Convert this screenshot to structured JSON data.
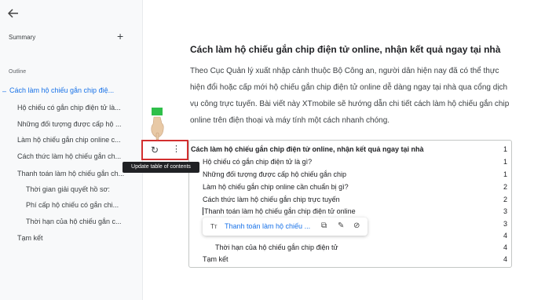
{
  "sidebar": {
    "back_icon": "arrow-left-icon",
    "summary_label": "Summary",
    "add_icon": "+",
    "outline_label": "Outline",
    "items": [
      {
        "label": "Cách làm hộ chiếu gắn chip điệ..."
      },
      {
        "label": "Hộ chiếu có gắn chip điện tử là..."
      },
      {
        "label": "Những đối tượng được cấp hộ ..."
      },
      {
        "label": "Làm hộ chiếu gắn chip online c..."
      },
      {
        "label": "Cách thức làm hộ chiếu gắn ch..."
      },
      {
        "label": "Thanh toán làm hộ chiếu gắn ch..."
      },
      {
        "label": "Thời gian giải quyết hồ sơ:"
      },
      {
        "label": "Phí cấp hộ chiếu có gắn chi..."
      },
      {
        "label": "Thời hạn của hộ chiếu gắn c..."
      },
      {
        "label": "Tạm kết"
      }
    ]
  },
  "document": {
    "heading": "Cách làm hộ chiếu gắn chip điện tử online, nhận kết quả ngay tại nhà",
    "paragraph": "Theo Cục Quản lý xuất nhập cảnh thuộc Bộ Công an, người dân hiện nay đã có thể thực hiện đổi hoặc cấp mới hộ chiếu gắn chip điện tử online dễ dàng ngay tại nhà qua cổng dịch vụ công trực tuyến. Bài viết này XTmobile sẽ hướng dẫn chi tiết cách làm hộ chiếu gắn chip online trên điện thoại và máy tính một cách nhanh chóng."
  },
  "toc": {
    "rows": [
      {
        "text": "Cách làm hộ chiếu gắn chip điện tử online, nhận kết quả ngay tại nhà",
        "page": "1"
      },
      {
        "text": "Hộ chiếu có gắn chip điện tử là gì?",
        "page": "1"
      },
      {
        "text": "Những đối tượng được cấp hộ chiếu gắn chip",
        "page": "1"
      },
      {
        "text": "Làm hộ chiếu gắn chip online cần chuẩn bị gì?",
        "page": "2"
      },
      {
        "text": "Cách thức làm hộ chiếu gắn chip trực tuyến",
        "page": "2"
      },
      {
        "text": "Thanh toán làm hộ chiếu gắn chip điện tử online",
        "page": "3"
      },
      {
        "text": "",
        "page": "3"
      },
      {
        "text": "",
        "page": "4"
      },
      {
        "text": "Thời hạn của hộ chiếu gắn chip điện tử",
        "page": "4"
      },
      {
        "text": "Tạm kết",
        "page": "4"
      }
    ]
  },
  "toolbar": {
    "refresh_icon": "↻",
    "more_icon": "⋮",
    "tooltip": "Update table of contents"
  },
  "link_chip": {
    "text_style_icon": "Tт",
    "link_text": "Thanh toán làm hộ chiếu ...",
    "copy_icon": "⧉",
    "edit_icon": "✎",
    "unlink_icon": "⊘"
  }
}
